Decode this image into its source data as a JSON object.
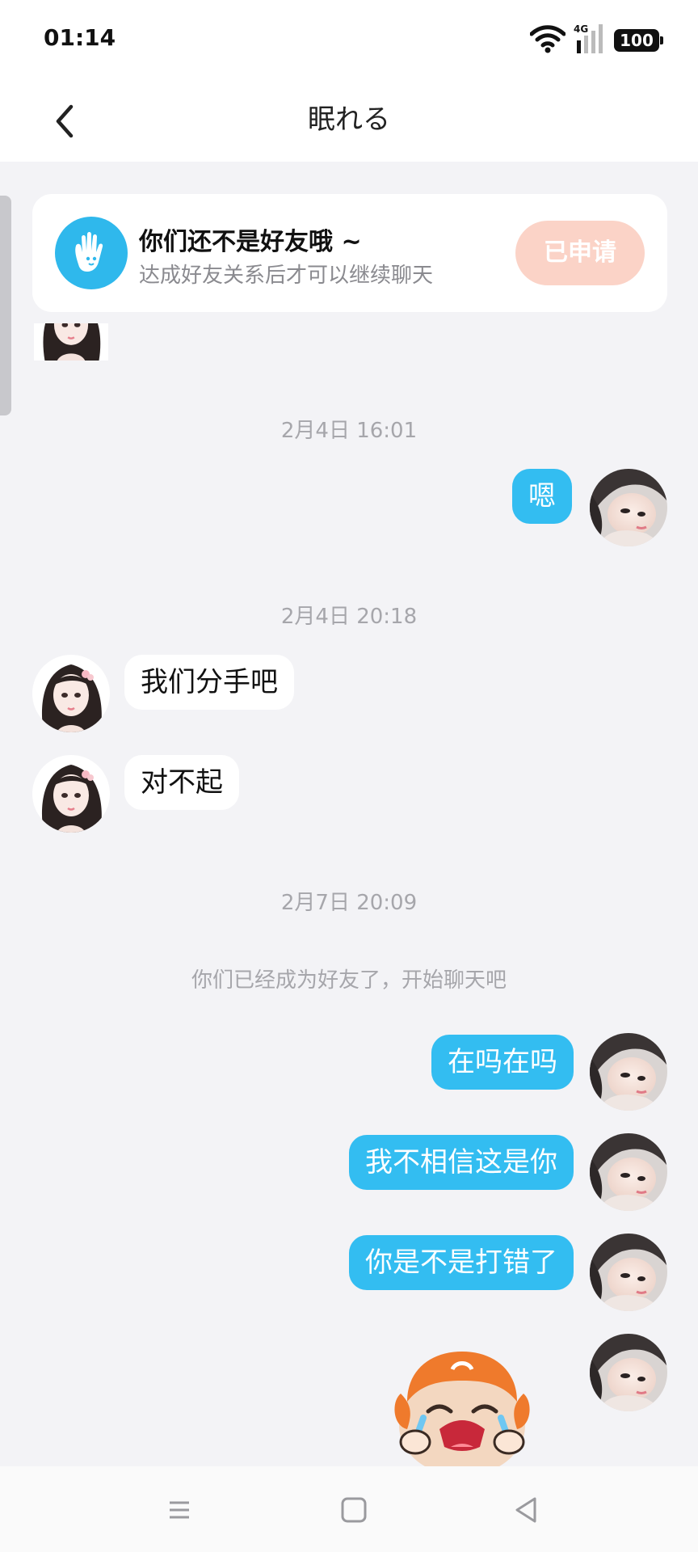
{
  "status_bar": {
    "time": "01:14",
    "network": "4G",
    "battery": "100"
  },
  "header": {
    "title": "眠れる",
    "back_icon": "chevron-left-icon"
  },
  "friend_banner": {
    "title": "你们还不是好友哦 ~",
    "subtitle": "达成好友关系后才可以继续聊天",
    "button_label": "已申请",
    "icon": "waving-hand-icon",
    "accent": "#2fb8ec",
    "button_color": "#fbd3c7"
  },
  "chat": {
    "ts1": "2月4日 16:01",
    "msg1": "嗯",
    "ts2": "2月4日 20:18",
    "msg2": "我们分手吧",
    "msg3": "对不起",
    "ts3": "2月7日 20:09",
    "system_notice": "你们已经成为好友了，开始聊天吧",
    "msg4": "在吗在吗",
    "msg5": "我不相信这是你",
    "msg6": "你是不是打错了",
    "sticker": "crying-cartoon-sticker"
  },
  "colors": {
    "outgoing_bubble": "#33bdf1",
    "incoming_bubble": "#ffffff",
    "background": "#f3f3f6"
  },
  "nav_bar": {
    "icons": [
      "menu-icon",
      "home-icon",
      "back-triangle-icon"
    ]
  }
}
